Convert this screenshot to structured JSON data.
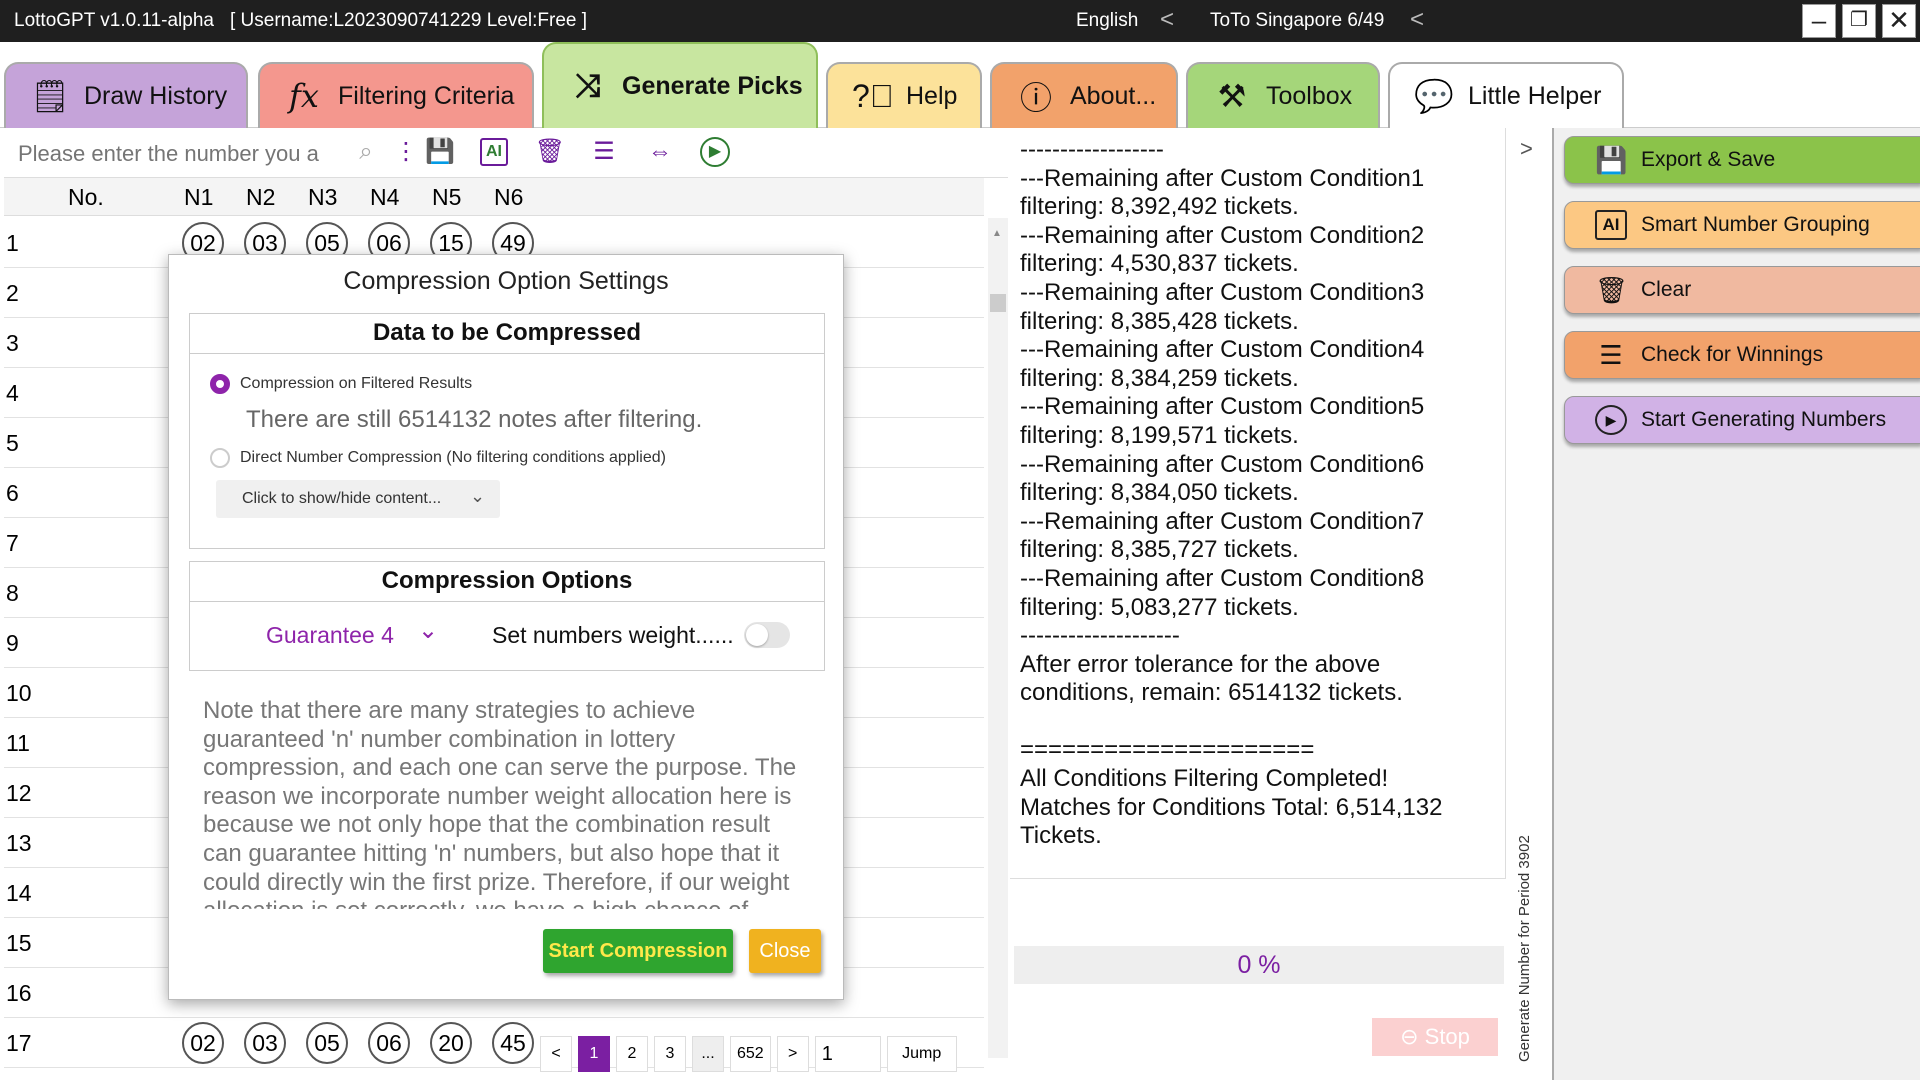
{
  "window": {
    "app_title": "LottoGPT v1.0.11-alpha",
    "user_info": "[ Username:L2023090741229  Level:Free ]",
    "language": "English",
    "game": "ToTo Singapore 6/49",
    "arrow": "<"
  },
  "tabs": [
    {
      "label": "Draw History",
      "color": "#c5a3d9"
    },
    {
      "label": "Filtering Criteria",
      "color": "#f4978e"
    },
    {
      "label": "Generate Picks",
      "color": "#c8e6a0"
    },
    {
      "label": "Help",
      "color": "#fce29a"
    },
    {
      "label": "About...",
      "color": "#f2a26b"
    },
    {
      "label": "Toolbox",
      "color": "#a5d67a"
    },
    {
      "label": "Little Helper",
      "color": "#ffffff"
    }
  ],
  "toolbar": {
    "search_placeholder": "Please enter the number you a"
  },
  "grid": {
    "columns": [
      "No.",
      "N1",
      "N2",
      "N3",
      "N4",
      "N5",
      "N6"
    ],
    "rows": [
      {
        "no": "1",
        "nums": [
          "02",
          "03",
          "05",
          "06",
          "15",
          "49"
        ]
      },
      {
        "no": "2",
        "nums": []
      },
      {
        "no": "3",
        "nums": []
      },
      {
        "no": "4",
        "nums": []
      },
      {
        "no": "5",
        "nums": []
      },
      {
        "no": "6",
        "nums": []
      },
      {
        "no": "7",
        "nums": []
      },
      {
        "no": "8",
        "nums": []
      },
      {
        "no": "9",
        "nums": []
      },
      {
        "no": "10",
        "nums": []
      },
      {
        "no": "11",
        "nums": []
      },
      {
        "no": "12",
        "nums": []
      },
      {
        "no": "13",
        "nums": []
      },
      {
        "no": "14",
        "nums": []
      },
      {
        "no": "15",
        "nums": []
      },
      {
        "no": "16",
        "nums": []
      },
      {
        "no": "17",
        "nums": [
          "02",
          "03",
          "05",
          "06",
          "20",
          "45"
        ]
      }
    ]
  },
  "pager": {
    "prev": "<",
    "pages": [
      "1",
      "2",
      "3",
      "...",
      "652"
    ],
    "next": ">",
    "page_input": "1",
    "jump": "Jump"
  },
  "modal": {
    "title": "Compression Option Settings",
    "data_section_title": "Data to be Compressed",
    "option_filtered": "Compression on Filtered Results",
    "filtered_info": "There are still 6514132 notes after filtering.",
    "option_direct": "Direct Number Compression (No filtering conditions applied)",
    "toggle_content": "Click to show/hide content...",
    "options_section_title": "Compression Options",
    "guarantee": "Guarantee 4",
    "weight_label": "Set numbers weight......",
    "note": "Note that there are many strategies to achieve guaranteed 'n' number combination in lottery compression, and each one can serve the purpose. The reason we incorporate number weight allocation here is because we not only hope that the combination result can guarantee hitting 'n' numbers, but also hope that it could directly win the first prize. Therefore, if our weight allocation is set correctly, we have a high chance of",
    "start_button": "Start Compression",
    "close_button": "Close",
    "accent": "#8e24aa"
  },
  "log": {
    "text": "------------------\n---Remaining after Custom Condition1 filtering: 8,392,492 tickets.\n---Remaining after Custom Condition2 filtering: 4,530,837 tickets.\n---Remaining after Custom Condition3 filtering: 8,385,428 tickets.\n---Remaining after Custom Condition4 filtering: 8,384,259 tickets.\n---Remaining after Custom Condition5 filtering: 8,199,571 tickets.\n---Remaining after Custom Condition6 filtering: 8,384,050 tickets.\n---Remaining after Custom Condition7 filtering: 8,385,727 tickets.\n---Remaining after Custom Condition8 filtering: 5,083,277 tickets.\n--------------------\nAfter error tolerance for the above conditions, remain: 6514132 tickets.\n\n=====================\nAll Conditions Filtering Completed!\nMatches for Conditions Total: 6,514,132 Tickets."
  },
  "progress": {
    "text": "0 %",
    "value": 0
  },
  "stop_button": "Stop",
  "side_label": "Generate Number for Period 3902",
  "panel_toggle": ">",
  "actions": [
    {
      "label": "Export & Save",
      "color": "#8bc34a"
    },
    {
      "label": "Smart Number Grouping",
      "color": "#fcc883"
    },
    {
      "label": "Clear",
      "color": "#f0b9a0"
    },
    {
      "label": "Check for Winnings",
      "color": "#f2a26b"
    },
    {
      "label": "Start Generating Numbers",
      "color": "#d1b2e6"
    }
  ]
}
